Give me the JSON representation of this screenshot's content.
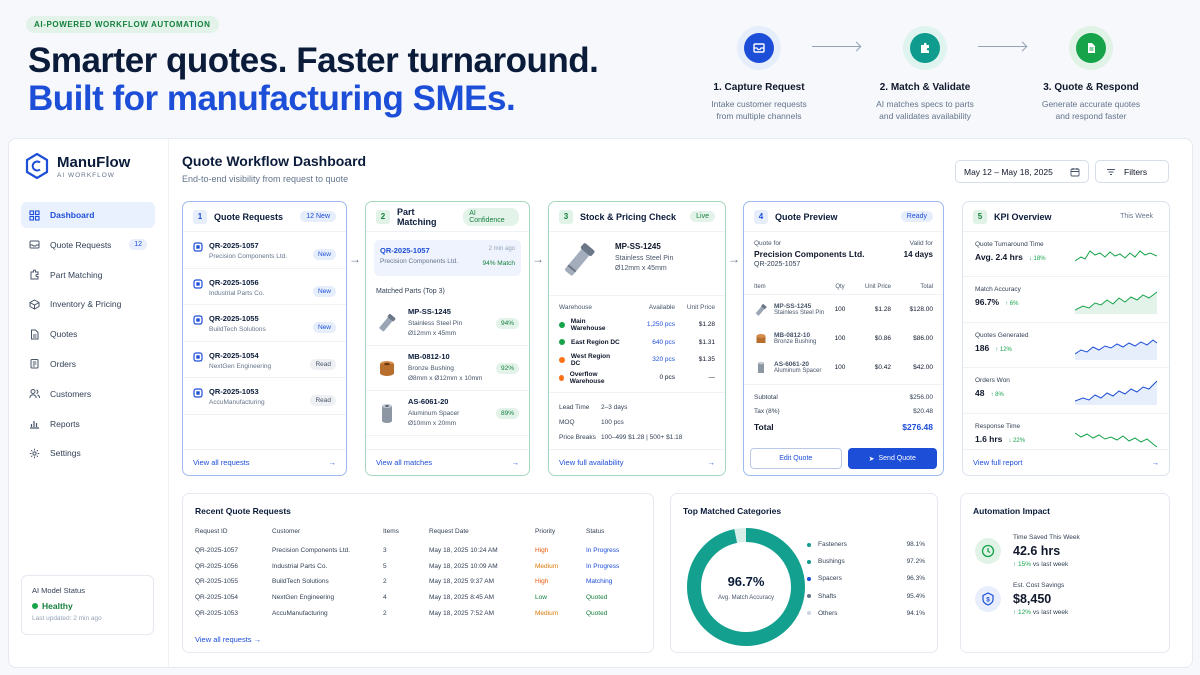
{
  "hero": {
    "badge": "AI-POWERED WORKFLOW AUTOMATION",
    "title": "Smarter quotes. Faster turnaround.",
    "subtitle": "Built for manufacturing SMEs."
  },
  "steps": [
    {
      "title": "1. Capture Request",
      "desc1": "Intake customer requests",
      "desc2": "from multiple channels",
      "color": "#1d4ed8"
    },
    {
      "title": "2. Match & Validate",
      "desc1": "AI matches specs to parts",
      "desc2": "and validates availability",
      "color": "#0f9b8e"
    },
    {
      "title": "3. Quote & Respond",
      "desc1": "Generate accurate quotes",
      "desc2": "and respond faster",
      "color": "#16a34a"
    }
  ],
  "brand": {
    "name": "ManuFlow",
    "tagline": "AI WORKFLOW"
  },
  "nav": [
    {
      "label": "Dashboard",
      "icon": "grid-icon"
    },
    {
      "label": "Quote Requests",
      "count": "12",
      "icon": "inbox-icon"
    },
    {
      "label": "Part Matching",
      "icon": "puzzle-icon"
    },
    {
      "label": "Inventory & Pricing",
      "icon": "box-icon"
    },
    {
      "label": "Quotes",
      "icon": "document-icon"
    },
    {
      "label": "Orders",
      "icon": "orders-icon"
    },
    {
      "label": "Customers",
      "icon": "users-icon"
    },
    {
      "label": "Reports",
      "icon": "chart-icon"
    },
    {
      "label": "Settings",
      "icon": "gear-icon"
    }
  ],
  "ai_status": {
    "title": "AI Model Status",
    "state": "Healthy",
    "updated": "Last updated: 2 min ago"
  },
  "dashboard": {
    "title": "Quote Workflow Dashboard",
    "subtitle": "End-to-end visibility from request to quote",
    "date_range": "May 12 – May 18, 2025",
    "filters": "Filters"
  },
  "quote_requests": {
    "num": "1",
    "title": "Quote Requests",
    "badge": "12 New",
    "footer": "View all requests",
    "items": [
      {
        "id": "QR-2025-1057",
        "company": "Precision Components Ltd.",
        "status": "New"
      },
      {
        "id": "QR-2025-1056",
        "company": "Industrial Parts Co.",
        "status": "New"
      },
      {
        "id": "QR-2025-1055",
        "company": "BuildTech Solutions",
        "status": "New"
      },
      {
        "id": "QR-2025-1054",
        "company": "NextGen Engineering",
        "status": "Read"
      },
      {
        "id": "QR-2025-1053",
        "company": "AccuManufacturing",
        "status": "Read"
      }
    ]
  },
  "part_matching": {
    "num": "2",
    "title": "Part Matching",
    "badge": "AI Confidence",
    "footer": "View all matches",
    "selected": {
      "id": "QR-2025-1057",
      "company": "Precision Components Ltd.",
      "ago": "2 min ago",
      "match": "94% Match"
    },
    "section": "Matched Parts (Top 3)",
    "parts": [
      {
        "pn": "MP-SS-1245",
        "desc": "Stainless Steel Pin",
        "dim": "Ø12mm x 45mm",
        "score": "94%"
      },
      {
        "pn": "MB-0812-10",
        "desc": "Bronze Bushing",
        "dim": "Ø8mm x Ø12mm x 10mm",
        "score": "92%"
      },
      {
        "pn": "AS-6061-20",
        "desc": "Aluminum Spacer",
        "dim": "Ø10mm x 20mm",
        "score": "89%"
      }
    ]
  },
  "stock": {
    "num": "3",
    "title": "Stock & Pricing Check",
    "badge": "Live",
    "footer": "View full availability",
    "part": {
      "pn": "MP-SS-1245",
      "desc": "Stainless Steel Pin",
      "dim": "Ø12mm x 45mm"
    },
    "headers": {
      "warehouse": "Warehouse",
      "available": "Available",
      "unit_price": "Unit Price"
    },
    "rows": [
      {
        "name": "Main Warehouse",
        "available": "1,250 pcs",
        "price": "$1.28",
        "color": "#16a34a"
      },
      {
        "name": "East Region DC",
        "available": "640 pcs",
        "price": "$1.31",
        "color": "#16a34a"
      },
      {
        "name": "West Region DC",
        "available": "320 pcs",
        "price": "$1.35",
        "color": "#f97316"
      },
      {
        "name": "Overflow Warehouse",
        "available": "0 pcs",
        "price": "—",
        "color": "#f97316"
      }
    ],
    "lead_k": "Lead Time",
    "lead_v": "2–3 days",
    "moq_k": "MOQ",
    "moq_v": "100 pcs",
    "pb_k": "Price Breaks",
    "pb_v": "100–499  $1.28  |  500+  $1.18"
  },
  "preview": {
    "num": "4",
    "title": "Quote Preview",
    "badge": "Ready",
    "quote_for": "Quote for",
    "customer": "Precision Components Ltd.",
    "qid": "QR-2025-1057",
    "valid_k": "Valid for",
    "valid_v": "14 days",
    "headers": {
      "item": "Item",
      "qty": "Qty",
      "unit": "Unit Price",
      "total": "Total"
    },
    "items": [
      {
        "pn": "MP-SS-1245",
        "desc": "Stainless Steel Pin",
        "qty": "100",
        "unit": "$1.28",
        "total": "$128.00"
      },
      {
        "pn": "MB-0812-10",
        "desc": "Bronze Bushing",
        "qty": "100",
        "unit": "$0.86",
        "total": "$86.00"
      },
      {
        "pn": "AS-6061-20",
        "desc": "Aluminum Spacer",
        "qty": "100",
        "unit": "$0.42",
        "total": "$42.00"
      }
    ],
    "subtotal_k": "Subtotal",
    "subtotal_v": "$256.00",
    "tax_k": "Tax (8%)",
    "tax_v": "$20.48",
    "total_k": "Total",
    "total_v": "$276.48",
    "edit": "Edit Quote",
    "send": "Send Quote"
  },
  "kpi": {
    "num": "5",
    "title": "KPI Overview",
    "period": "This Week",
    "footer": "View full report",
    "items": [
      {
        "label": "Quote Turnaround Time",
        "value": "Avg. 2.4 hrs",
        "change": "↓ 18%",
        "color": "#16a34a"
      },
      {
        "label": "Match Accuracy",
        "value": "96.7%",
        "change": "↑ 6%",
        "color": "#16a34a"
      },
      {
        "label": "Quotes Generated",
        "value": "186",
        "change": "↑ 12%",
        "color": "#1d4ed8"
      },
      {
        "label": "Orders Won",
        "value": "48",
        "change": "↑ 8%",
        "color": "#1d4ed8"
      },
      {
        "label": "Response Time",
        "value": "1.6 hrs",
        "change": "↓ 22%",
        "color": "#16a34a"
      }
    ]
  },
  "recent": {
    "title": "Recent Quote Requests",
    "footer": "View all requests",
    "headers": [
      "Request ID",
      "Customer",
      "Items",
      "Request Date",
      "Priority",
      "Status"
    ],
    "rows": [
      [
        "QR-2025-1057",
        "Precision Components Ltd.",
        "3",
        "May 18, 2025 10:24 AM",
        "High",
        "In Progress"
      ],
      [
        "QR-2025-1056",
        "Industrial Parts Co.",
        "5",
        "May 18, 2025 10:09 AM",
        "Medium",
        "In Progress"
      ],
      [
        "QR-2025-1055",
        "BuildTech Solutions",
        "2",
        "May 18, 2025 9:37 AM",
        "High",
        "Matching"
      ],
      [
        "QR-2025-1054",
        "NextGen Engineering",
        "4",
        "May 18, 2025 8:45 AM",
        "Low",
        "Quoted"
      ],
      [
        "QR-2025-1053",
        "AccuManufacturing",
        "2",
        "May 18, 2025 7:52 AM",
        "Medium",
        "Quoted"
      ]
    ]
  },
  "categories": {
    "title": "Top Matched Categories",
    "center_value": "96.7%",
    "center_label": "Avg. Match Accuracy",
    "items": [
      {
        "name": "Fasteners",
        "value": "98.1%",
        "color": "#0f9b8e"
      },
      {
        "name": "Bushings",
        "value": "97.2%",
        "color": "#0f9b8e"
      },
      {
        "name": "Spacers",
        "value": "96.3%",
        "color": "#1d4ed8"
      },
      {
        "name": "Shafts",
        "value": "95.4%",
        "color": "#64748b"
      },
      {
        "name": "Others",
        "value": "94.1%",
        "color": "#cbd5e1"
      }
    ]
  },
  "automation": {
    "title": "Automation Impact",
    "items": [
      {
        "label": "Time Saved This Week",
        "value": "42.6 hrs",
        "delta": "↑ 15%",
        "note": "vs last week",
        "icon": "clock-icon"
      },
      {
        "label": "Est. Cost Savings",
        "value": "$8,450",
        "delta": "↑ 12%",
        "note": "vs last week",
        "icon": "coin-icon"
      }
    ]
  }
}
